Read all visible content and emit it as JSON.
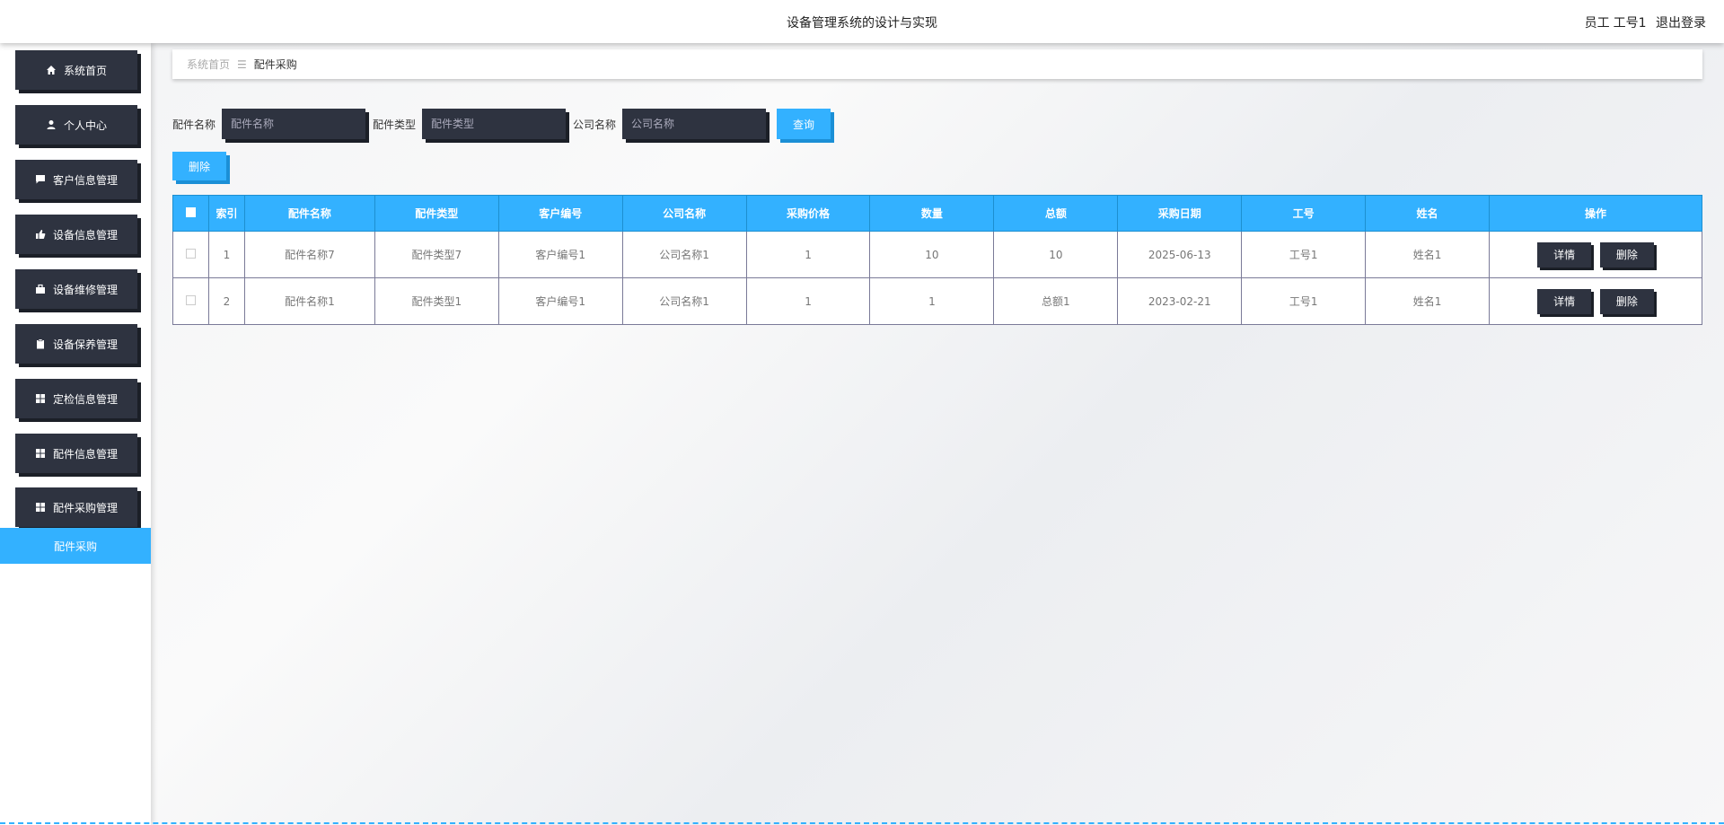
{
  "header": {
    "title": "设备管理系统的设计与实现",
    "user_role": "员工",
    "user_name": "工号1",
    "logout": "退出登录"
  },
  "sidebar": {
    "items": [
      {
        "label": "系统首页",
        "icon": "home-icon"
      },
      {
        "label": "个人中心",
        "icon": "user-icon"
      },
      {
        "label": "客户信息管理",
        "icon": "chat-icon"
      },
      {
        "label": "设备信息管理",
        "icon": "thumb-icon"
      },
      {
        "label": "设备维修管理",
        "icon": "briefcase-icon"
      },
      {
        "label": "设备保养管理",
        "icon": "clipboard-icon"
      },
      {
        "label": "定检信息管理",
        "icon": "grid-icon"
      },
      {
        "label": "配件信息管理",
        "icon": "grid-icon"
      },
      {
        "label": "配件采购管理",
        "icon": "grid-icon"
      }
    ],
    "active_sub": "配件采购"
  },
  "breadcrumb": {
    "home": "系统首页",
    "separator": "☰",
    "current": "配件采购"
  },
  "search": {
    "name_label": "配件名称",
    "name_placeholder": "配件名称",
    "type_label": "配件类型",
    "type_placeholder": "配件类型",
    "company_label": "公司名称",
    "company_placeholder": "公司名称",
    "query_button": "查询"
  },
  "toolbar": {
    "delete_button": "删除"
  },
  "table": {
    "headers": [
      "索引",
      "配件名称",
      "配件类型",
      "客户编号",
      "公司名称",
      "采购价格",
      "数量",
      "总额",
      "采购日期",
      "工号",
      "姓名",
      "操作"
    ],
    "rows": [
      {
        "index": "1",
        "name": "配件名称7",
        "type": "配件类型7",
        "customer_no": "客户编号1",
        "company": "公司名称1",
        "price": "1",
        "qty": "10",
        "total": "10",
        "date": "2025-06-13",
        "emp_no": "工号1",
        "emp_name": "姓名1",
        "detail": "详情",
        "delete": "删除"
      },
      {
        "index": "2",
        "name": "配件名称1",
        "type": "配件类型1",
        "customer_no": "客户编号1",
        "company": "公司名称1",
        "price": "1",
        "qty": "1",
        "total": "总额1",
        "date": "2023-02-21",
        "emp_no": "工号1",
        "emp_name": "姓名1",
        "detail": "详情",
        "delete": "删除"
      }
    ]
  },
  "colors": {
    "accent": "#33b1ff",
    "dark": "#2e3340"
  }
}
